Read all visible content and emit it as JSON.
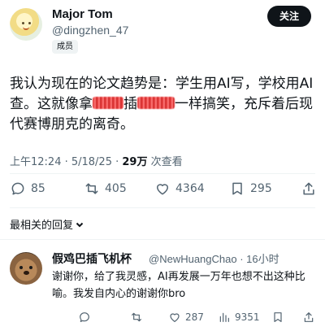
{
  "post": {
    "author_name": "Major Tom",
    "author_handle": "@dingzhen_47",
    "badge": "成员",
    "follow_label": "关注",
    "text_before_redact_1": "我认为现在的论文趋势是：学生用AI写，学校用AI查。这就像拿",
    "text_middle": "插",
    "text_after_redact_2": "一样搞笑，充斥着后现代赛博朋克的离奇。",
    "time": "上午12:24 · 5/18/25 · ",
    "views_count": "29万",
    "views_label": " 次查看"
  },
  "actions": {
    "replies": "85",
    "reposts": "405",
    "likes": "4364",
    "bookmarks": "295"
  },
  "replies_sort_label": "最相关的回复",
  "reply": {
    "author_name": "假鸡巴插飞机杯",
    "author_handle": "@NewHuangChao · 16小时",
    "text": "谢谢你，给了我灵感，AI再发展一万年也想不出这种比喻。我发自内心的谢谢你bro",
    "actions": {
      "reposts": "",
      "likes": "287",
      "views": "9351"
    }
  }
}
